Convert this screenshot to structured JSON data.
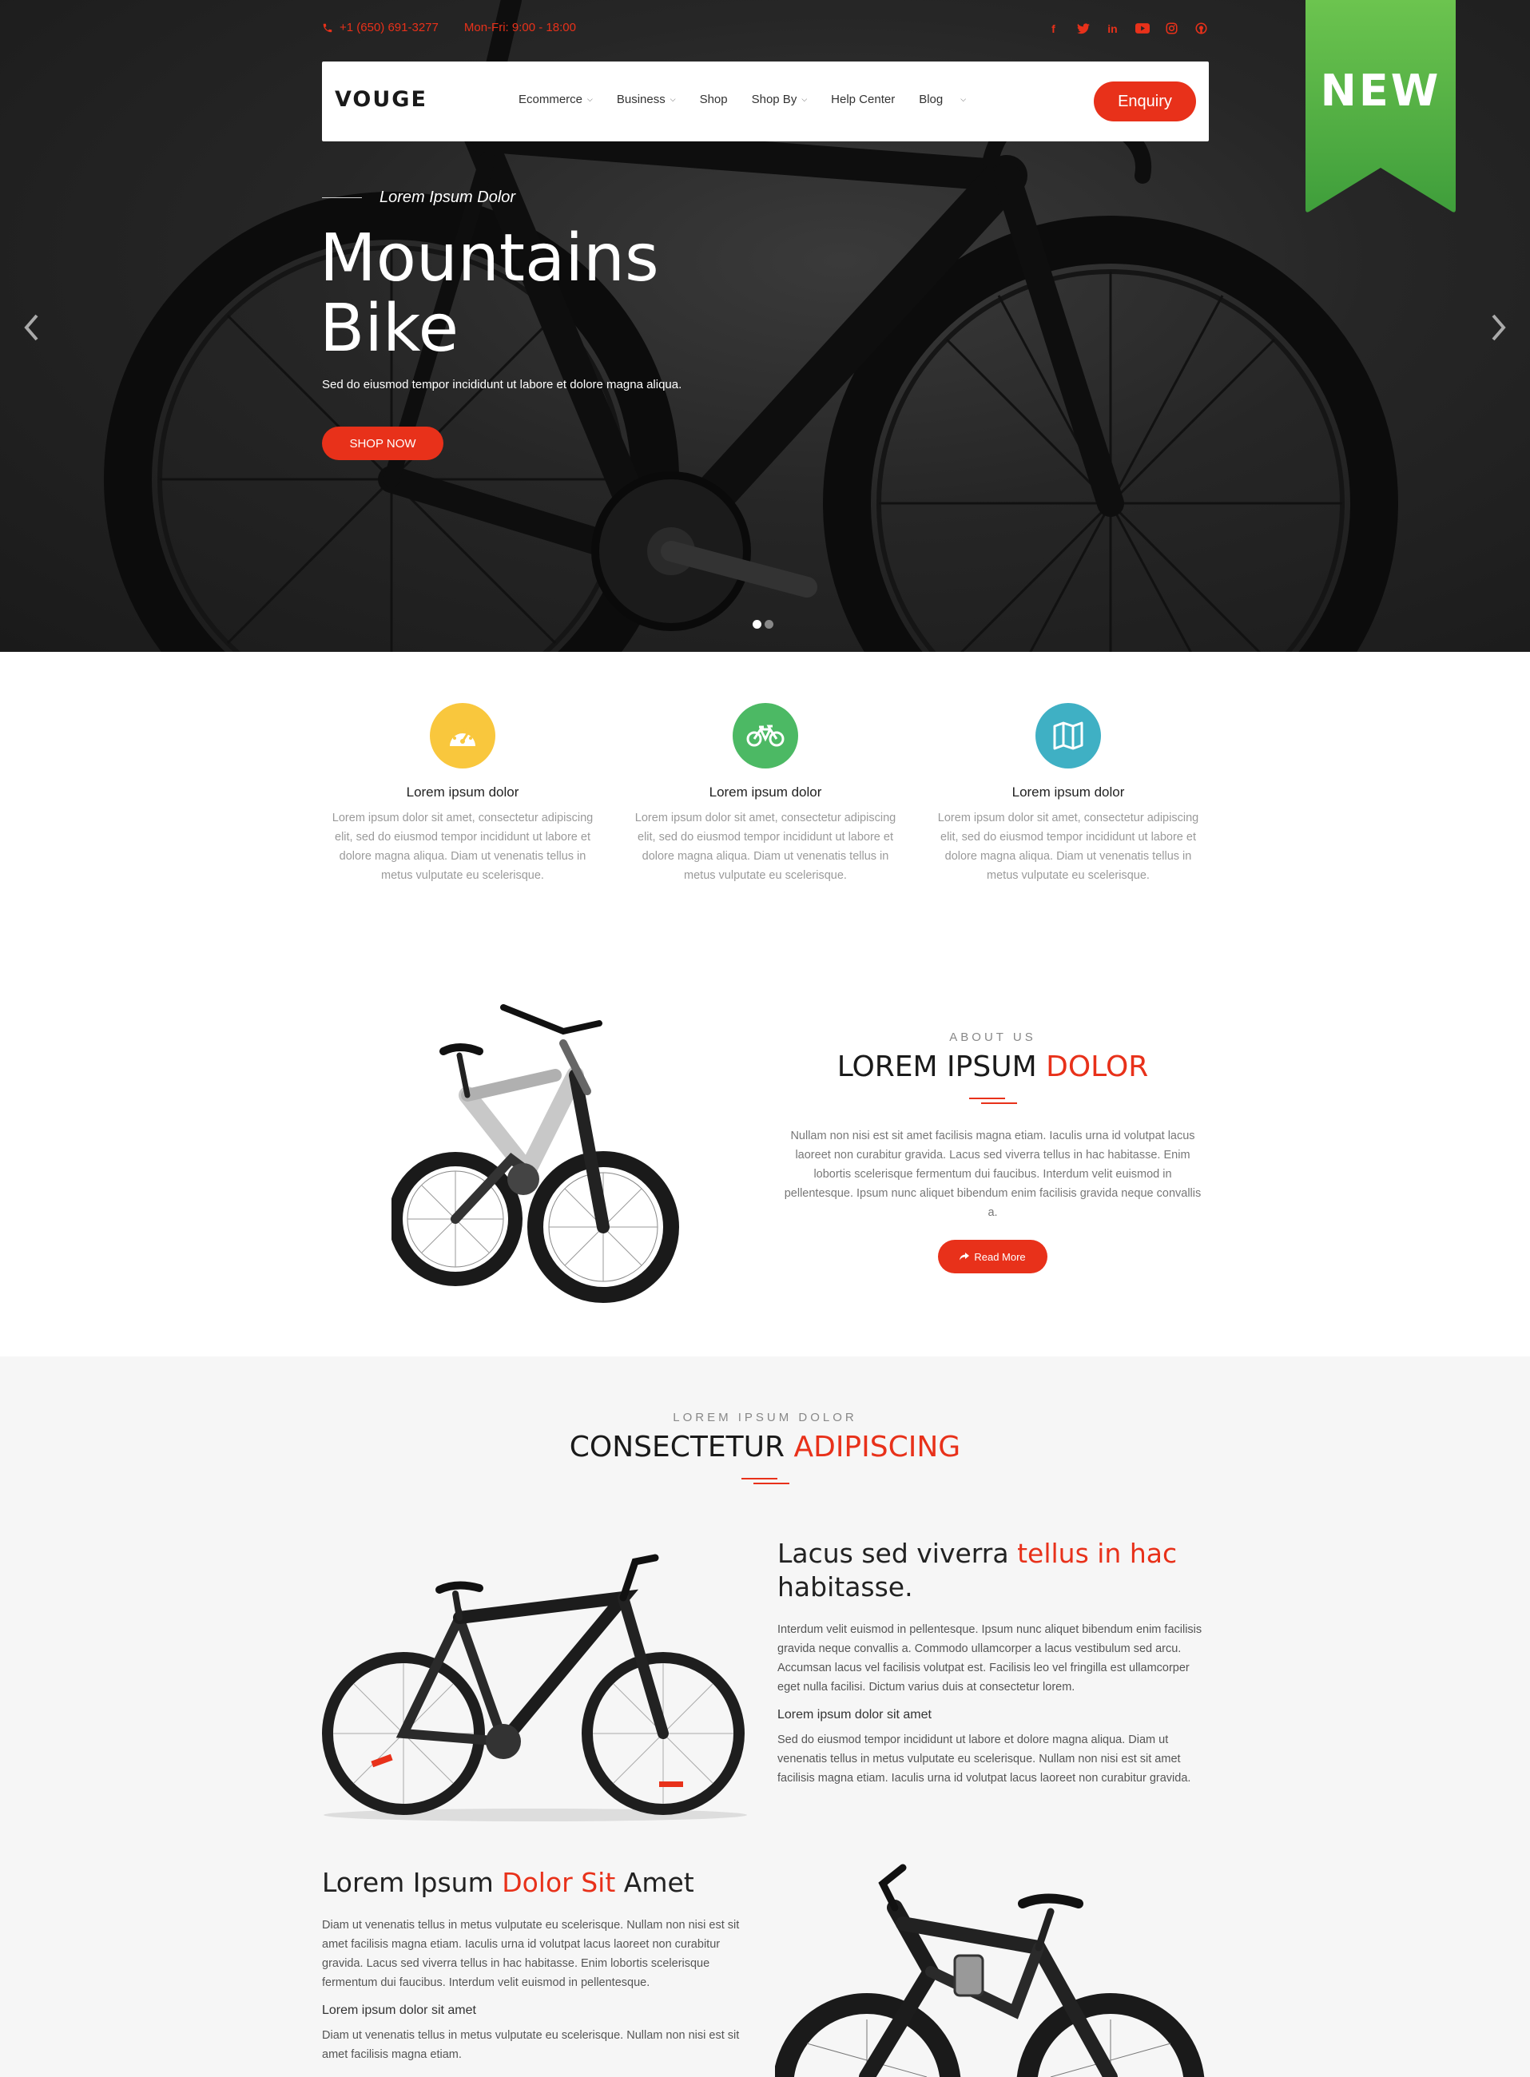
{
  "topbar": {
    "phone": "+1 (650) 691-3277",
    "hours": "Mon-Fri: 9:00 - 18:00"
  },
  "socials": [
    "facebook-icon",
    "twitter-icon",
    "linkedin-icon",
    "youtube-icon",
    "instagram-icon",
    "github-icon"
  ],
  "nav": {
    "logo": "VOUGE",
    "items": [
      {
        "label": "Ecommerce",
        "dropdown": true
      },
      {
        "label": "Business",
        "dropdown": true
      },
      {
        "label": "Shop",
        "dropdown": false
      },
      {
        "label": "Shop By",
        "dropdown": true
      },
      {
        "label": "Help Center",
        "dropdown": false
      },
      {
        "label": "Blog",
        "dropdown": true
      }
    ],
    "enquiry": "Enquiry"
  },
  "hero": {
    "subtitle": "Lorem Ipsum Dolor",
    "title": "Mountains Bike",
    "description": "Sed do eiusmod tempor incididunt ut labore et dolore magna aliqua.",
    "cta": "SHOP NOW",
    "ribbon": "NEW"
  },
  "features": [
    {
      "icon": "speedometer-icon",
      "color": "#f9c73d",
      "title": "Lorem ipsum dolor",
      "text": "Lorem ipsum dolor sit amet, consectetur adipiscing elit, sed do eiusmod tempor incididunt ut labore et dolore magna aliqua. Diam ut venenatis tellus in metus vulputate eu scelerisque."
    },
    {
      "icon": "bicycle-icon",
      "color": "#4cb964",
      "title": "Lorem ipsum dolor",
      "text": "Lorem ipsum dolor sit amet, consectetur adipiscing elit, sed do eiusmod tempor incididunt ut labore et dolore magna aliqua. Diam ut venenatis tellus in metus vulputate eu scelerisque."
    },
    {
      "icon": "map-icon",
      "color": "#3fb0c4",
      "title": "Lorem ipsum dolor",
      "text": "Lorem ipsum dolor sit amet, consectetur adipiscing elit, sed do eiusmod tempor incididunt ut labore et dolore magna aliqua. Diam ut venenatis tellus in metus vulputate eu scelerisque."
    }
  ],
  "about": {
    "eyebrow": "ABOUT US",
    "title_main": "LOREM IPSUM",
    "title_accent": "DOLOR",
    "text": "Nullam non nisi est sit amet facilisis magna etiam. Iaculis urna id volutpat lacus laoreet non curabitur gravida. Lacus sed viverra tellus in hac habitasse. Enim lobortis scelerisque fermentum dui faucibus. Interdum velit euismod in pellentesque. Ipsum nunc aliquet bibendum enim facilisis gravida neque convallis a.",
    "button": "Read More"
  },
  "products": {
    "eyebrow": "LOREM IPSUM DOLOR",
    "title_main": "CONSECTETUR",
    "title_accent": "ADIPISCING",
    "item1": {
      "title_a": "Lacus sed viverra ",
      "title_accent": "tellus in hac",
      "title_b": "habitasse.",
      "para": "Interdum velit euismod in pellentesque. Ipsum nunc aliquet bibendum enim facilisis gravida neque convallis a. Commodo ullamcorper a lacus vestibulum sed arcu. Accumsan lacus vel facilisis volutpat est. Facilisis leo vel fringilla est ullamcorper eget nulla facilisi. Dictum varius duis at consectetur lorem.",
      "sub": "Lorem ipsum dolor sit amet",
      "para2": "Sed do eiusmod tempor incididunt ut labore et dolore magna aliqua. Diam ut venenatis tellus in metus vulputate eu scelerisque. Nullam non nisi est sit amet facilisis magna etiam. Iaculis urna id volutpat lacus laoreet non curabitur gravida."
    },
    "item2": {
      "title_a": "Lorem Ipsum ",
      "title_accent": "Dolor Sit",
      "title_b": " Amet",
      "para": "Diam ut venenatis tellus in metus vulputate eu scelerisque. Nullam non nisi est sit amet facilisis magna etiam. Iaculis urna id volutpat lacus laoreet non curabitur gravida. Lacus sed viverra tellus in hac habitasse. Enim lobortis scelerisque fermentum dui faucibus. Interdum velit euismod in pellentesque.",
      "sub": "Lorem ipsum dolor sit amet",
      "para2": "Diam ut venenatis tellus in metus vulputate eu scelerisque. Nullam non nisi est sit amet facilisis magna etiam."
    }
  }
}
